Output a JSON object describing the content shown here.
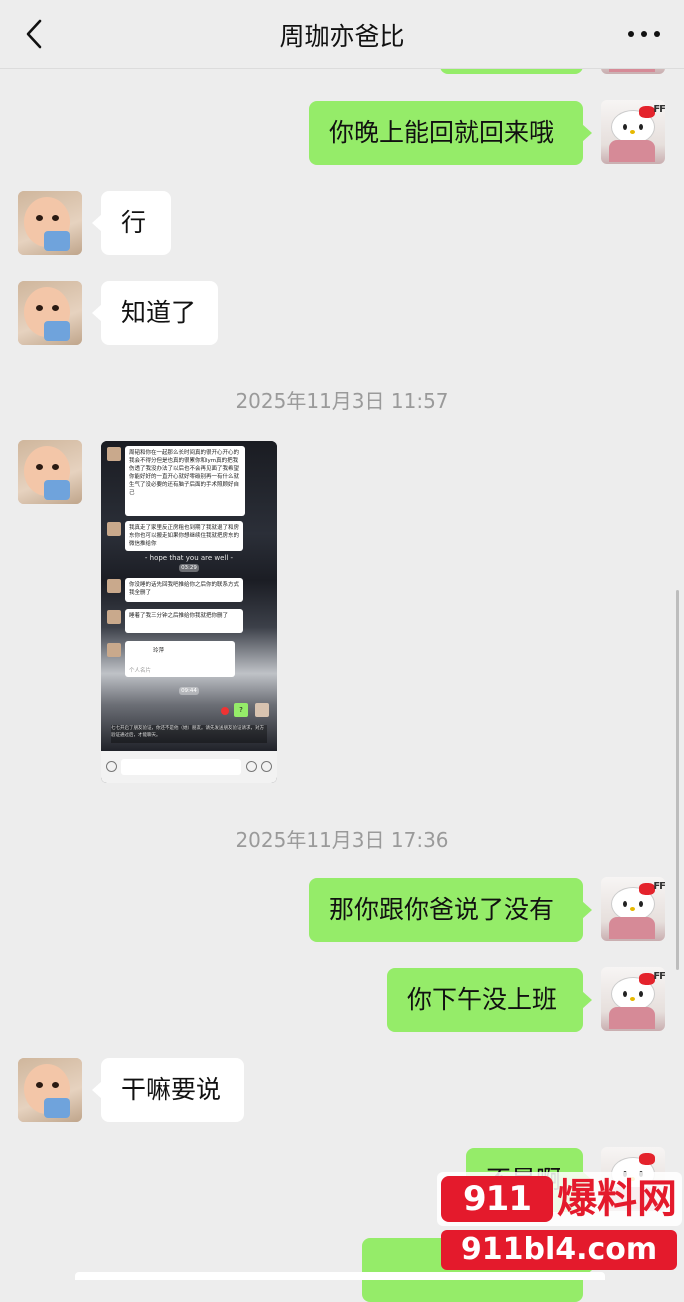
{
  "header": {
    "title": "周珈亦爸比",
    "back_icon": "chevron-left-icon",
    "more_icon": "more-dots-icon"
  },
  "timestamps": [
    "2025年11月3日 11:57",
    "2025年11月3日 17:36"
  ],
  "messages": [
    {
      "side": "right",
      "text": "你晚上能回就回来哦"
    },
    {
      "side": "left",
      "text": "行"
    },
    {
      "side": "left",
      "text": "知道了"
    },
    {
      "side": "right",
      "text": "那你跟你爸说了没有"
    },
    {
      "side": "right",
      "text": "你下午没上班"
    },
    {
      "side": "left",
      "text": "干嘛要说"
    },
    {
      "side": "right",
      "text": "不是啊"
    }
  ],
  "image_message": {
    "msg1": "周韬和你在一起那么长时间真的很开心开心的我会不得分但是也真的很累你和lym真的把我伤透了我没办法了以后也不会再见面了我希望你能好好的一直开心就好零碳别再一有什么就生气了没必要的还有脑子后面的手术照顾好自己",
    "msg2": "我真走了家里反正房租也到期了我就退了和房东你也可以搬走如果你想继续住我就把房东的微信推给你",
    "caption": "- hope that you are well -",
    "dur1": "03:29",
    "msg3": "你没睡的话先回我吧推给你之后你的联系方式我全删了",
    "msg4": "睡着了我三分钟之后推给你我就把你删了",
    "card_name": "玲萍",
    "card_sub": "个人名片",
    "dur2": "09:44",
    "reply": "?",
    "system": "七七开启了朋友验证，你还不是他（她）朋友。请先发送朋友验证请求，对方验证通过后，才能聊天。"
  },
  "watermark": {
    "badge": "911",
    "text": "爆料网",
    "url": "911bl4.com"
  },
  "colors": {
    "background": "#ededed",
    "sent_bubble": "#95ec69",
    "received_bubble": "#ffffff",
    "watermark_red": "#e41a2c"
  }
}
